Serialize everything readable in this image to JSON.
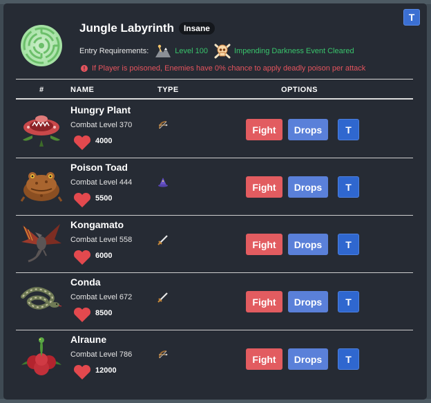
{
  "header": {
    "corner_button": "T",
    "title": "Jungle Labyrinth",
    "difficulty": "Insane",
    "requirements_label": "Entry Requirements:",
    "requirements": [
      {
        "icon": "agility-icon",
        "text": "Level 100"
      },
      {
        "icon": "skull-crossbones-icon",
        "text": "Impending Darkness Event Cleared"
      }
    ],
    "warning": "If Player is poisoned, Enemies have 0% chance to apply deadly poison per attack"
  },
  "table": {
    "columns": [
      "#",
      "NAME",
      "TYPE",
      "OPTIONS"
    ],
    "rows": [
      {
        "name": "Hungry Plant",
        "combat_level": "Combat Level 370",
        "hp": "4000",
        "type_icon": "ranged-icon",
        "fight": "Fight",
        "drops": "Drops",
        "t": "T"
      },
      {
        "name": "Poison Toad",
        "combat_level": "Combat Level 444",
        "hp": "5500",
        "type_icon": "magic-icon",
        "fight": "Fight",
        "drops": "Drops",
        "t": "T"
      },
      {
        "name": "Kongamato",
        "combat_level": "Combat Level 558",
        "hp": "6000",
        "type_icon": "melee-icon",
        "fight": "Fight",
        "drops": "Drops",
        "t": "T"
      },
      {
        "name": "Conda",
        "combat_level": "Combat Level 672",
        "hp": "8500",
        "type_icon": "melee-icon",
        "fight": "Fight",
        "drops": "Drops",
        "t": "T"
      },
      {
        "name": "Alraune",
        "combat_level": "Combat Level 786",
        "hp": "12000",
        "type_icon": "ranged-icon",
        "fight": "Fight",
        "drops": "Drops",
        "t": "T"
      }
    ]
  },
  "colors": {
    "panel": "#262b34",
    "fight": "#e25c60",
    "drops": "#5a80d9",
    "t_button": "#2f67cf",
    "requirement_met": "#39c46c",
    "warning": "#e6545e"
  }
}
